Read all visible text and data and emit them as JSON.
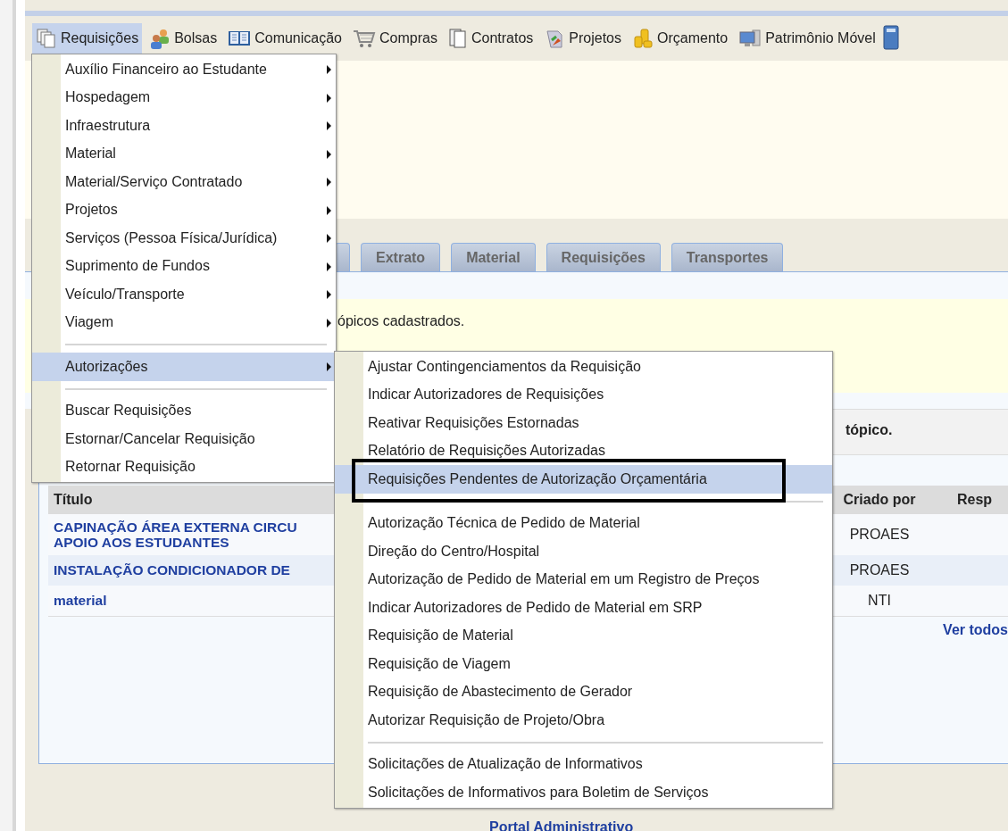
{
  "menubar": [
    {
      "label": "Requisições",
      "selected": true
    },
    {
      "label": "Bolsas",
      "selected": false
    },
    {
      "label": "Comunicação",
      "selected": false
    },
    {
      "label": "Compras",
      "selected": false
    },
    {
      "label": "Contratos",
      "selected": false
    },
    {
      "label": "Projetos",
      "selected": false
    },
    {
      "label": "Orçamento",
      "selected": false
    },
    {
      "label": "Patrimônio Móvel",
      "selected": false
    }
  ],
  "tabs": [
    {
      "label": "Extrato",
      "selected": false
    },
    {
      "label": "Material",
      "selected": false
    },
    {
      "label": "Requisições",
      "selected": false
    },
    {
      "label": "Transportes",
      "selected": false
    }
  ],
  "notice": "ópicos cadastrados.",
  "panel_header": "tópico.",
  "table": {
    "columns": [
      "Título",
      "Criado por",
      "Resp"
    ],
    "rows": [
      {
        "title": "CAPINAÇÃO ÁREA EXTERNA CIRCU",
        "title_line_2": "APOIO AOS ESTUDANTES",
        "created_by": "PROAES"
      },
      {
        "title": "INSTALAÇÃO CONDICIONADOR DE",
        "created_by": "PROAES"
      },
      {
        "title": "material",
        "created_by": "NTI"
      }
    ],
    "see_all": "Ver todos"
  },
  "footer_link": "Portal Administrativo",
  "menu": [
    {
      "kind": "item",
      "label": "Auxílio Financeiro ao Estudante",
      "submenu": true,
      "selected": false
    },
    {
      "kind": "item",
      "label": "Hospedagem",
      "submenu": true,
      "selected": false
    },
    {
      "kind": "item",
      "label": "Infraestrutura",
      "submenu": true,
      "selected": false
    },
    {
      "kind": "item",
      "label": "Material",
      "submenu": true,
      "selected": false
    },
    {
      "kind": "item",
      "label": "Material/Serviço Contratado",
      "submenu": true,
      "selected": false
    },
    {
      "kind": "item",
      "label": "Projetos",
      "submenu": true,
      "selected": false
    },
    {
      "kind": "item",
      "label": "Serviços (Pessoa Física/Jurídica)",
      "submenu": true,
      "selected": false
    },
    {
      "kind": "item",
      "label": "Suprimento de Fundos",
      "submenu": true,
      "selected": false
    },
    {
      "kind": "item",
      "label": "Veículo/Transporte",
      "submenu": true,
      "selected": false
    },
    {
      "kind": "item",
      "label": "Viagem",
      "submenu": true,
      "selected": false
    },
    {
      "kind": "separator"
    },
    {
      "kind": "item",
      "label": "Autorizações",
      "submenu": true,
      "selected": true
    },
    {
      "kind": "separator"
    },
    {
      "kind": "item",
      "label": "Buscar Requisições",
      "submenu": false,
      "selected": false
    },
    {
      "kind": "item",
      "label": "Estornar/Cancelar Requisição",
      "submenu": false,
      "selected": false
    },
    {
      "kind": "item",
      "label": "Retornar Requisição",
      "submenu": false,
      "selected": false
    }
  ],
  "submenu": [
    {
      "kind": "item",
      "label": "Ajustar Contingenciamentos da Requisição",
      "selected": false,
      "outlined": false
    },
    {
      "kind": "item",
      "label": "Indicar Autorizadores de Requisições",
      "selected": false,
      "outlined": false
    },
    {
      "kind": "item",
      "label": "Reativar Requisições Estornadas",
      "selected": false,
      "outlined": false
    },
    {
      "kind": "item",
      "label": "Relatório de Requisições Autorizadas",
      "selected": false,
      "outlined": false
    },
    {
      "kind": "item",
      "label": "Requisições Pendentes de Autorização Orçamentária",
      "selected": true,
      "outlined": true
    },
    {
      "kind": "separator"
    },
    {
      "kind": "item",
      "label": "Autorização Técnica de Pedido de Material",
      "selected": false,
      "outlined": false
    },
    {
      "kind": "item",
      "label": "Direção do Centro/Hospital",
      "selected": false,
      "outlined": false
    },
    {
      "kind": "item",
      "label": "Autorização de Pedido de Material em um Registro de Preços",
      "selected": false,
      "outlined": false
    },
    {
      "kind": "item",
      "label": "Indicar Autorizadores de Pedido de Material em SRP",
      "selected": false,
      "outlined": false
    },
    {
      "kind": "item",
      "label": "Requisição de Material",
      "selected": false,
      "outlined": false
    },
    {
      "kind": "item",
      "label": "Requisição de Viagem",
      "selected": false,
      "outlined": false
    },
    {
      "kind": "item",
      "label": "Requisição de Abastecimento de Gerador",
      "selected": false,
      "outlined": false
    },
    {
      "kind": "item",
      "label": "Autorizar Requisição de Projeto/Obra",
      "selected": false,
      "outlined": false
    },
    {
      "kind": "separator"
    },
    {
      "kind": "item",
      "label": "Solicitações de Atualização de Informativos",
      "selected": false,
      "outlined": false
    },
    {
      "kind": "item",
      "label": "Solicitações de Informativos para Boletim de Serviços",
      "selected": false,
      "outlined": false
    }
  ]
}
